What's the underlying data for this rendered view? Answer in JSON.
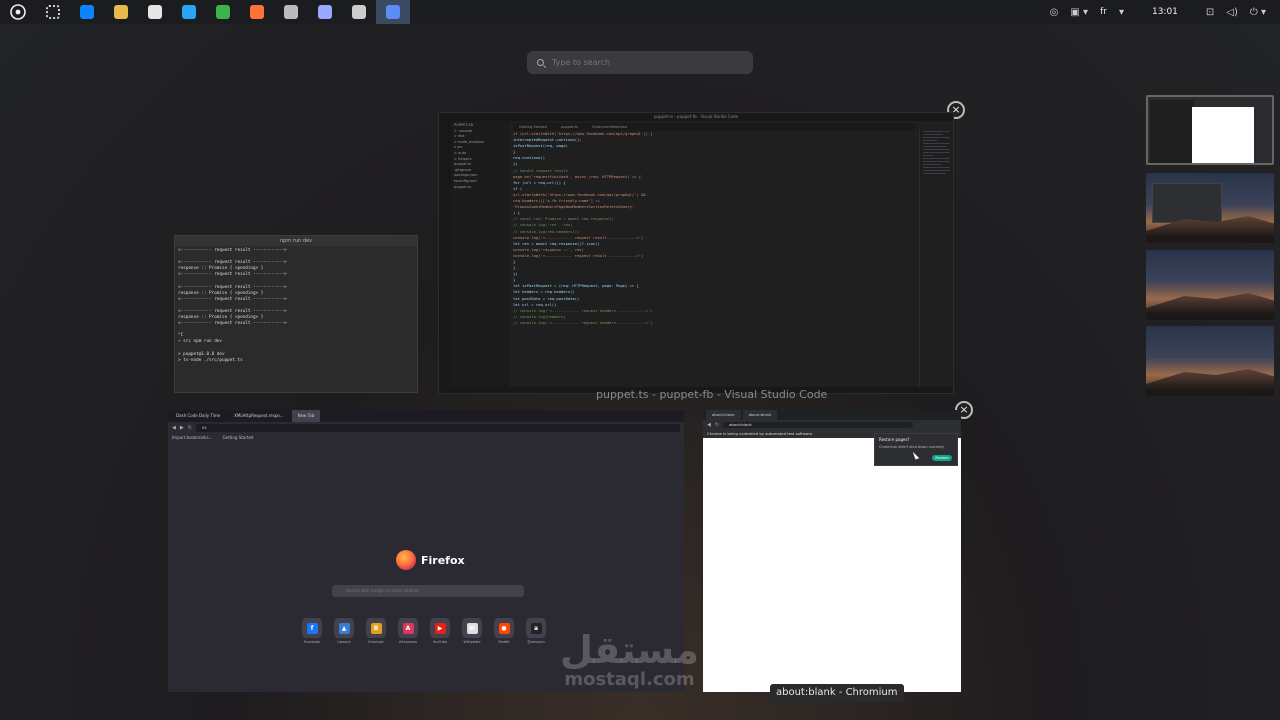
{
  "taskbar": {
    "apps": [
      {
        "name": "apps-grid-icon",
        "color": "#cfcfcf"
      },
      {
        "name": "edge-icon",
        "color": "#0a84ff"
      },
      {
        "name": "files-icon",
        "color": "#e8b84a"
      },
      {
        "name": "store-icon",
        "color": "#e6e6e6"
      },
      {
        "name": "vscode-icon",
        "color": "#2aa4f4"
      },
      {
        "name": "chrome-icon",
        "color": "#3bb54a"
      },
      {
        "name": "firefox-icon",
        "color": "#ff7139"
      },
      {
        "name": "terminal-icon",
        "color": "#bbbbbb"
      },
      {
        "name": "calculator-icon",
        "color": "#9aa6ff"
      },
      {
        "name": "settings-icon",
        "color": "#cccccc"
      },
      {
        "name": "chromium-icon",
        "color": "#5c8df6"
      }
    ],
    "tray": {
      "lang": "fr",
      "clock": "13:01"
    }
  },
  "search": {
    "placeholder": "Type to search"
  },
  "terminal": {
    "title": "npm run dev",
    "lines": "<------------ request result ------------>\n\n<------------ request result ------------>\nresponse :: Promise { <pending> }\n<------------ request result ------------>\n\n<------------ request result ------------>\nresponse :: Promise { <pending> }\n<------------ request result ------------>\n\n<------------ request result ------------>\nresponse :: Promise { <pending> }\n<------------ request result ------------>\n\n^C\n→ src npm run dev\n\n> puppet@1.0.0 dev\n> ts-node ./src/puppet.ts\n"
  },
  "vscode": {
    "title": "puppet.ts - puppet-fb - Visual Studio Code",
    "caption": "puppet.ts - puppet-fb - Visual Studio Code",
    "tabs": [
      "Getting Started",
      "puppet.ts",
      "ChromiumSelectors"
    ],
    "explorer": [
      "PUPPET-FB",
      "> .vscode",
      "> dist",
      "> node_modules",
      "v src",
      "  > auth",
      "  > helpers",
      "  puppet.ts",
      "  .gitignore",
      "  package.json",
      "  tsconfig.json",
      "  puppet.ts"
    ],
    "code": [
      "    if (url.startsWith('https://www.facebook.com/api/graphql')) {",
      "        interceptedRequest.continue();",
      "        isPostRequest(req, page)",
      "    }",
      "",
      "    req.continue()",
      "  })",
      "",
      "  // handle request result",
      "  page.on('requestfinished', async (req: HTTPRequest) => {",
      "    for (url = req.url()) {",
      "      if (",
      "        url.startsWith('https://www.facebook.com/api/graphql/') &&",
      "        req.headers()['x-fb-friendly-name'] ==",
      "          'GroupsCometMembersPageNewMembersSectionRefetchQuery'",
      "      ) {",
      "        // const res: Promise = await req.response()",
      "        // console.log('res', res)",
      "        // console.log(req.headers())",
      "        console.log('<------------ request result ------------>')",
      "",
      "        let res = await req.response()?.json()",
      "        console.log('response ::', res)",
      "",
      "        console.log('<------------ request result ------------>')",
      "      }",
      "    }",
      "  })",
      "}",
      "",
      "let isPostRequest = (req: HTTPRequest, page: Page) => {",
      "  let headers = req.headers()",
      "",
      "  let postData = req.postData()",
      "  let url = req.url()",
      "  // console.log('<------------ request headers ------------>')",
      "  // console.log(headers)",
      "",
      "  // console.log('<------------ request headers ------------>')"
    ]
  },
  "firefox": {
    "tabs": [
      "Dash Code Daily Time",
      "XMLHttpRequest.respo...",
      "New Tab"
    ],
    "url": "ex",
    "bookmarks": [
      "Import bookmarks...",
      "Getting Started"
    ],
    "brand": "Firefox",
    "search_placeholder": "Search with Google or enter address",
    "shortcuts": [
      {
        "label": "Facebook",
        "color": "#1877f2",
        "glyph": "f"
      },
      {
        "label": "Upwork",
        "color": "#3a7bd5",
        "glyph": "▲"
      },
      {
        "label": "Khamsat",
        "color": "#e0a21b",
        "glyph": "B"
      },
      {
        "label": "Aliexpress",
        "color": "#d93a5b",
        "glyph": "A"
      },
      {
        "label": "YouTube",
        "color": "#e62117",
        "glyph": "▶"
      },
      {
        "label": "Wikipedia",
        "color": "#dddddd",
        "glyph": "W"
      },
      {
        "label": "Reddit",
        "color": "#ff4500",
        "glyph": "●"
      },
      {
        "label": "@amazon",
        "color": "#222222",
        "glyph": "a"
      }
    ]
  },
  "chromium": {
    "tabs": [
      "about:blank",
      "about:blank"
    ],
    "url": "about:blank",
    "infobar": "Chrome is being controlled by automated test software.",
    "restore_title": "Restore pages?",
    "restore_text": "Chromium didn't shut down correctly.",
    "restore_button": "Restore",
    "caption": "about:blank - Chromium"
  },
  "watermark": {
    "arabic": "مستقل",
    "latin": "mostaql.com"
  }
}
